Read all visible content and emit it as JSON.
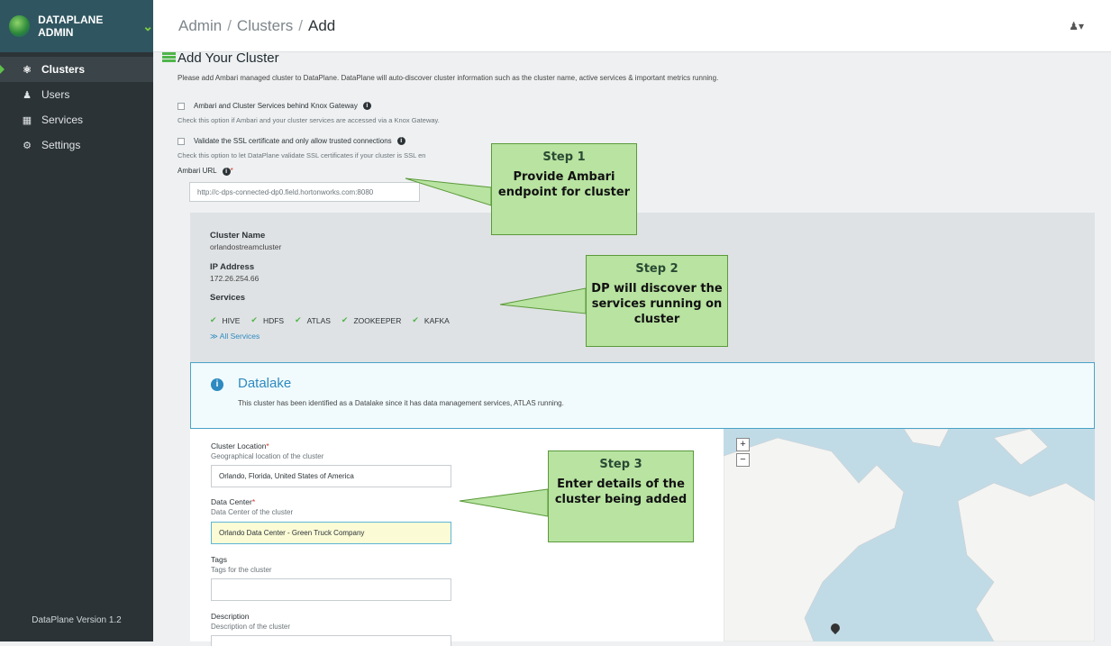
{
  "sidebar": {
    "brand": "DATAPLANE ADMIN",
    "items": [
      {
        "label": "Clusters",
        "icon": "clusters-icon"
      },
      {
        "label": "Users",
        "icon": "users-icon"
      },
      {
        "label": "Services",
        "icon": "services-icon"
      },
      {
        "label": "Settings",
        "icon": "gear-icon"
      }
    ],
    "version": "DataPlane Version 1.2"
  },
  "header": {
    "crumb1": "Admin",
    "crumb2": "Clusters",
    "crumb3": "Add",
    "separator": "/"
  },
  "page": {
    "title": "Add Your Cluster",
    "subtitle": "Please add Ambari managed cluster to DataPlane. DataPlane will auto-discover cluster information such as the cluster name, active services & important metrics running.",
    "knox_label": "Ambari and Cluster Services behind Knox Gateway",
    "knox_hint": "Check this option if Ambari and your cluster services are accessed via a Knox Gateway.",
    "ssl_label": "Validate the SSL certificate and only allow trusted connections",
    "ssl_hint": "Check this option to let DataPlane validate SSL certificates if your cluster is SSL en",
    "ambari_label": "Ambari URL",
    "ambari_value": "http://c-dps-connected-dp0.field.hortonworks.com:8080"
  },
  "cluster": {
    "name_label": "Cluster Name",
    "name": "orlandostreamcluster",
    "ip_label": "IP Address",
    "ip": "172.26.254.66",
    "services_label": "Services",
    "services": [
      "HIVE",
      "HDFS",
      "ATLAS",
      "ZOOKEEPER",
      "KAFKA"
    ],
    "all_services": "≫ All Services"
  },
  "datalake": {
    "title": "Datalake",
    "text": "This cluster has been identified as a Datalake since it has data management services, ATLAS running."
  },
  "form": {
    "location_label": "Cluster Location",
    "location_hint": "Geographical location of the cluster",
    "location_value": "Orlando, Florida, United States of America",
    "dc_label": "Data Center",
    "dc_hint": "Data Center of the cluster",
    "dc_value": "Orlando Data Center - Green Truck Company",
    "tags_label": "Tags",
    "tags_hint": "Tags for the cluster",
    "desc_label": "Description",
    "desc_hint": "Description of the cluster"
  },
  "map": {
    "zoom_in": "+",
    "zoom_out": "−"
  },
  "callouts": [
    {
      "step": "Step 1",
      "text": "Provide Ambari endpoint for cluster"
    },
    {
      "step": "Step 2",
      "text": "DP will discover the services running on cluster"
    },
    {
      "step": "Step 3",
      "text": "Enter details of the cluster being added"
    }
  ],
  "colors": {
    "accent": "#4fb54a",
    "sidebar": "#2c3337",
    "link": "#2e8ac0",
    "callout": "#b8e3a1"
  }
}
